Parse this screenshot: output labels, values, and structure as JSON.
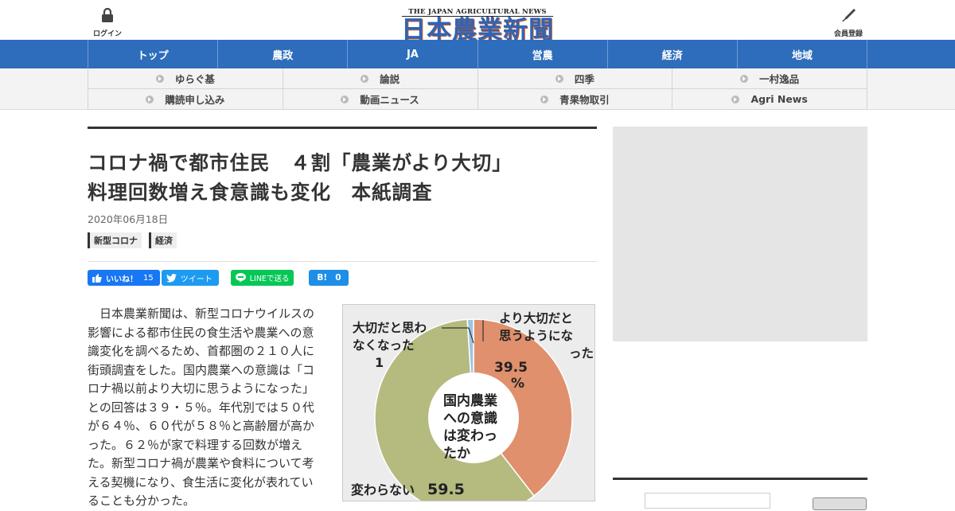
{
  "header": {
    "login_label": "ログイン",
    "member_label": "会員登録",
    "logo_en": "THE JAPAN AGRICULTURAL NEWS",
    "logo_jp": "日本農業新聞",
    "logo_color": "#2e64b6"
  },
  "nav": {
    "color": "#2e6dbb",
    "items": [
      {
        "label": "トップ"
      },
      {
        "label": "農政"
      },
      {
        "label": "JA"
      },
      {
        "label": "営農"
      },
      {
        "label": "経済"
      },
      {
        "label": "地域"
      }
    ]
  },
  "subnav": {
    "items": [
      {
        "label": "ゆらぐ基"
      },
      {
        "label": "論説"
      },
      {
        "label": "四季"
      },
      {
        "label": "一村逸品"
      },
      {
        "label": "購読申し込み"
      },
      {
        "label": "動画ニュース"
      },
      {
        "label": "青果物取引"
      },
      {
        "label": "Agri News"
      }
    ]
  },
  "article": {
    "title_line1": "コロナ禍で都市住民　４割「農業がより大切」",
    "title_line2": "料理回数増え食意識も変化　本紙調査",
    "date": "2020年06月18日",
    "tags": [
      "新型コロナ",
      "経済"
    ],
    "social": {
      "like_label": "いいね！",
      "like_count": "15",
      "tweet_label": "ツイート",
      "line_label": "LINEで送る",
      "hatena_label": "B!",
      "hatena_count": "0"
    },
    "body": "日本農業新聞は、新型コロナウイルスの影響による都市住民の食生活や農業への意識変化を調べるため、首都圏の２１０人に街頭調査をした。国内農業への意識は「コロナ禍以前より大切に思うようになった」との回答は３９・５％。年代別では５０代が６４％、６０代が５８％と高齢層が高かった。６２％が家で料理する回数が増えた。新型コロナ禍が農業や食料について考える契機になり、食生活に変化が表れていることも分かった。"
  },
  "figure": {
    "center_label": [
      "国内農業",
      "への意識",
      "は変わっ",
      "たか"
    ],
    "label_less": [
      "大切だと思わ",
      "なくなった",
      "1"
    ],
    "label_more": [
      "より大切だと",
      "思うようにな",
      "った"
    ],
    "label_more_value": [
      "39.5",
      "%"
    ],
    "label_same": "変わらない",
    "label_same_value": "59.5",
    "colors": {
      "more": "#e0906c",
      "same": "#b5ba7f",
      "less": "#9cc4e0"
    }
  },
  "chart_data": {
    "type": "pie",
    "title": "国内農業への意識は変わったか",
    "categories": [
      "より大切だと思うようになった",
      "変わらない",
      "大切だと思わなくなった"
    ],
    "values": [
      39.5,
      59.5,
      1
    ]
  }
}
